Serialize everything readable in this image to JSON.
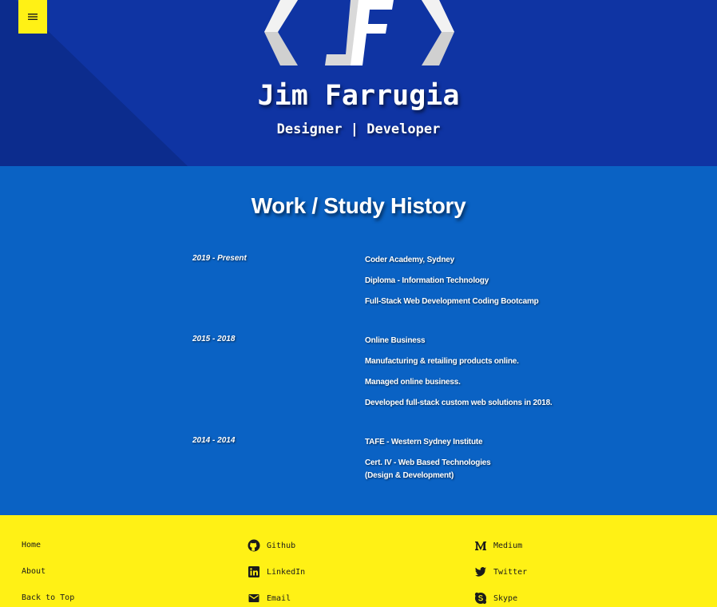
{
  "header": {
    "menu_label": "menu",
    "logo_label": "JF",
    "name": "Jim Farrugia",
    "tagline": "Designer | Developer"
  },
  "history": {
    "title": "Work / Study History",
    "entries": [
      {
        "date": "2019 - Present",
        "lines": [
          "Coder Academy, Sydney",
          "Diploma - Information Technology",
          "Full-Stack Web Development Coding Bootcamp"
        ]
      },
      {
        "date": "2015 - 2018",
        "lines": [
          "Online Business",
          "Manufacturing & retailing products online.",
          "Managed online business.",
          "Developed full-stack custom web solutions in 2018."
        ]
      },
      {
        "date": "2014 - 2014",
        "lines": [
          "TAFE - Western Sydney Institute",
          "Cert. IV - Web Based Technologies",
          "(Design & Development)"
        ]
      }
    ]
  },
  "footer": {
    "nav": [
      "Home",
      "About",
      "Back to Top"
    ],
    "social_mid": [
      {
        "label": "Github",
        "icon": "github-icon"
      },
      {
        "label": "LinkedIn",
        "icon": "linkedin-icon"
      },
      {
        "label": "Email",
        "icon": "email-icon"
      }
    ],
    "social_right": [
      {
        "label": "Medium",
        "icon": "medium-icon"
      },
      {
        "label": "Twitter",
        "icon": "twitter-icon"
      },
      {
        "label": "Skype",
        "icon": "skype-icon"
      }
    ]
  },
  "colors": {
    "header_bg": "#0f34a3",
    "section_bg": "#0a62c4",
    "accent_yellow": "#fff115"
  }
}
